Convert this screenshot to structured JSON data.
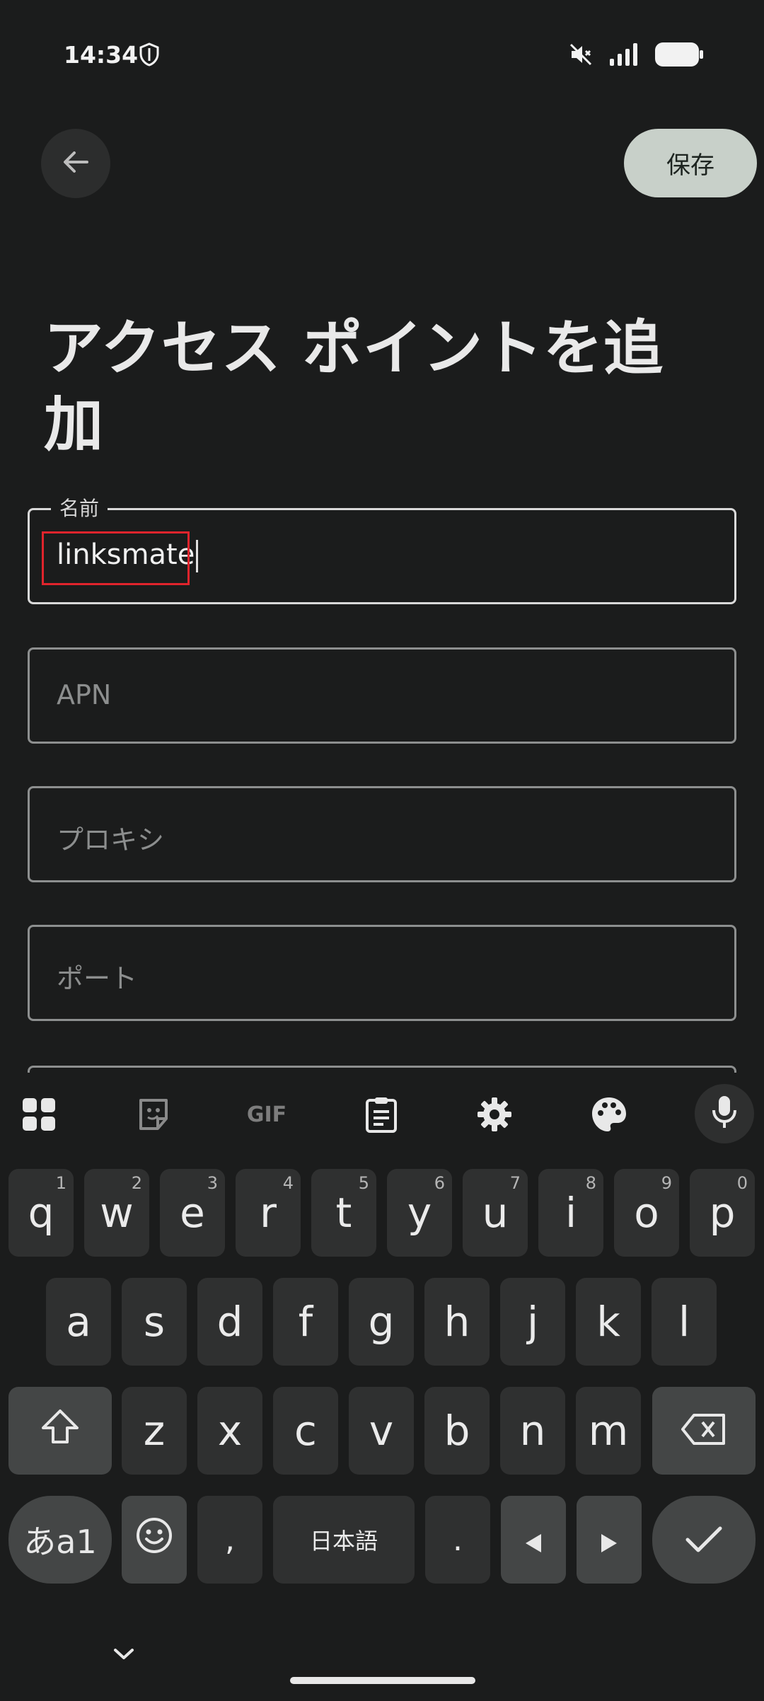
{
  "status_bar": {
    "time": "14:34",
    "icons": [
      "shield-icon",
      "mute-icon",
      "signal-icon",
      "battery-icon"
    ]
  },
  "app_bar": {
    "back_icon": "arrow-back-icon",
    "save_label": "保存"
  },
  "page": {
    "title": "アクセス ポイントを追加"
  },
  "fields": {
    "name": {
      "label": "名前",
      "value": "linksmate"
    },
    "apn": {
      "placeholder": "APN"
    },
    "proxy": {
      "placeholder": "プロキシ"
    },
    "port": {
      "placeholder": "ポート"
    }
  },
  "keyboard": {
    "toolbar": [
      "apps-icon",
      "sticker-icon",
      "gif-icon",
      "clipboard-icon",
      "settings-icon",
      "palette-icon",
      "mic-icon"
    ],
    "toolbar_gif": "GIF",
    "row1": [
      {
        "k": "q",
        "h": "1"
      },
      {
        "k": "w",
        "h": "2"
      },
      {
        "k": "e",
        "h": "3"
      },
      {
        "k": "r",
        "h": "4"
      },
      {
        "k": "t",
        "h": "5"
      },
      {
        "k": "y",
        "h": "6"
      },
      {
        "k": "u",
        "h": "7"
      },
      {
        "k": "i",
        "h": "8"
      },
      {
        "k": "o",
        "h": "9"
      },
      {
        "k": "p",
        "h": "0"
      }
    ],
    "row2": [
      "a",
      "s",
      "d",
      "f",
      "g",
      "h",
      "j",
      "k",
      "l"
    ],
    "row3": [
      "z",
      "x",
      "c",
      "v",
      "b",
      "n",
      "m"
    ],
    "mode_key": "あa1",
    "comma": ",",
    "space_label": "日本語",
    "period": "."
  },
  "colors": {
    "background": "#1b1c1c",
    "save_button": "#c8d0c9",
    "highlight": "#e0242c"
  }
}
